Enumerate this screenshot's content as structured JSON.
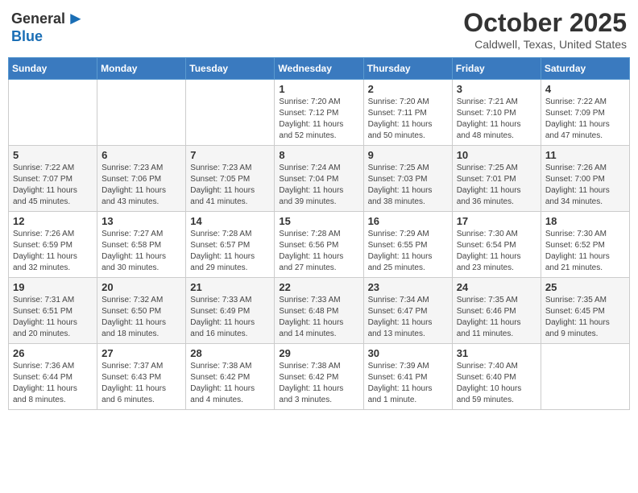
{
  "header": {
    "logo_general": "General",
    "logo_blue": "Blue",
    "month": "October 2025",
    "location": "Caldwell, Texas, United States"
  },
  "days_of_week": [
    "Sunday",
    "Monday",
    "Tuesday",
    "Wednesday",
    "Thursday",
    "Friday",
    "Saturday"
  ],
  "weeks": [
    [
      {
        "day": "",
        "info": ""
      },
      {
        "day": "",
        "info": ""
      },
      {
        "day": "",
        "info": ""
      },
      {
        "day": "1",
        "info": "Sunrise: 7:20 AM\nSunset: 7:12 PM\nDaylight: 11 hours and 52 minutes."
      },
      {
        "day": "2",
        "info": "Sunrise: 7:20 AM\nSunset: 7:11 PM\nDaylight: 11 hours and 50 minutes."
      },
      {
        "day": "3",
        "info": "Sunrise: 7:21 AM\nSunset: 7:10 PM\nDaylight: 11 hours and 48 minutes."
      },
      {
        "day": "4",
        "info": "Sunrise: 7:22 AM\nSunset: 7:09 PM\nDaylight: 11 hours and 47 minutes."
      }
    ],
    [
      {
        "day": "5",
        "info": "Sunrise: 7:22 AM\nSunset: 7:07 PM\nDaylight: 11 hours and 45 minutes."
      },
      {
        "day": "6",
        "info": "Sunrise: 7:23 AM\nSunset: 7:06 PM\nDaylight: 11 hours and 43 minutes."
      },
      {
        "day": "7",
        "info": "Sunrise: 7:23 AM\nSunset: 7:05 PM\nDaylight: 11 hours and 41 minutes."
      },
      {
        "day": "8",
        "info": "Sunrise: 7:24 AM\nSunset: 7:04 PM\nDaylight: 11 hours and 39 minutes."
      },
      {
        "day": "9",
        "info": "Sunrise: 7:25 AM\nSunset: 7:03 PM\nDaylight: 11 hours and 38 minutes."
      },
      {
        "day": "10",
        "info": "Sunrise: 7:25 AM\nSunset: 7:01 PM\nDaylight: 11 hours and 36 minutes."
      },
      {
        "day": "11",
        "info": "Sunrise: 7:26 AM\nSunset: 7:00 PM\nDaylight: 11 hours and 34 minutes."
      }
    ],
    [
      {
        "day": "12",
        "info": "Sunrise: 7:26 AM\nSunset: 6:59 PM\nDaylight: 11 hours and 32 minutes."
      },
      {
        "day": "13",
        "info": "Sunrise: 7:27 AM\nSunset: 6:58 PM\nDaylight: 11 hours and 30 minutes."
      },
      {
        "day": "14",
        "info": "Sunrise: 7:28 AM\nSunset: 6:57 PM\nDaylight: 11 hours and 29 minutes."
      },
      {
        "day": "15",
        "info": "Sunrise: 7:28 AM\nSunset: 6:56 PM\nDaylight: 11 hours and 27 minutes."
      },
      {
        "day": "16",
        "info": "Sunrise: 7:29 AM\nSunset: 6:55 PM\nDaylight: 11 hours and 25 minutes."
      },
      {
        "day": "17",
        "info": "Sunrise: 7:30 AM\nSunset: 6:54 PM\nDaylight: 11 hours and 23 minutes."
      },
      {
        "day": "18",
        "info": "Sunrise: 7:30 AM\nSunset: 6:52 PM\nDaylight: 11 hours and 21 minutes."
      }
    ],
    [
      {
        "day": "19",
        "info": "Sunrise: 7:31 AM\nSunset: 6:51 PM\nDaylight: 11 hours and 20 minutes."
      },
      {
        "day": "20",
        "info": "Sunrise: 7:32 AM\nSunset: 6:50 PM\nDaylight: 11 hours and 18 minutes."
      },
      {
        "day": "21",
        "info": "Sunrise: 7:33 AM\nSunset: 6:49 PM\nDaylight: 11 hours and 16 minutes."
      },
      {
        "day": "22",
        "info": "Sunrise: 7:33 AM\nSunset: 6:48 PM\nDaylight: 11 hours and 14 minutes."
      },
      {
        "day": "23",
        "info": "Sunrise: 7:34 AM\nSunset: 6:47 PM\nDaylight: 11 hours and 13 minutes."
      },
      {
        "day": "24",
        "info": "Sunrise: 7:35 AM\nSunset: 6:46 PM\nDaylight: 11 hours and 11 minutes."
      },
      {
        "day": "25",
        "info": "Sunrise: 7:35 AM\nSunset: 6:45 PM\nDaylight: 11 hours and 9 minutes."
      }
    ],
    [
      {
        "day": "26",
        "info": "Sunrise: 7:36 AM\nSunset: 6:44 PM\nDaylight: 11 hours and 8 minutes."
      },
      {
        "day": "27",
        "info": "Sunrise: 7:37 AM\nSunset: 6:43 PM\nDaylight: 11 hours and 6 minutes."
      },
      {
        "day": "28",
        "info": "Sunrise: 7:38 AM\nSunset: 6:42 PM\nDaylight: 11 hours and 4 minutes."
      },
      {
        "day": "29",
        "info": "Sunrise: 7:38 AM\nSunset: 6:42 PM\nDaylight: 11 hours and 3 minutes."
      },
      {
        "day": "30",
        "info": "Sunrise: 7:39 AM\nSunset: 6:41 PM\nDaylight: 11 hours and 1 minute."
      },
      {
        "day": "31",
        "info": "Sunrise: 7:40 AM\nSunset: 6:40 PM\nDaylight: 10 hours and 59 minutes."
      },
      {
        "day": "",
        "info": ""
      }
    ]
  ]
}
